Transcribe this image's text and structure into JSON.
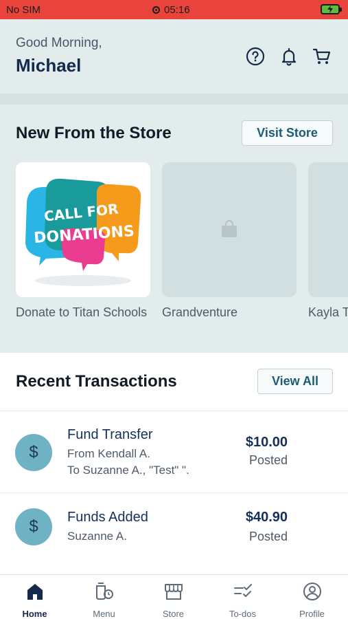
{
  "status_bar": {
    "carrier": "No SIM",
    "time": "05:16"
  },
  "header": {
    "greeting": "Good Morning,",
    "user_name": "Michael"
  },
  "store": {
    "title": "New From the Store",
    "visit_button": "Visit Store",
    "products": [
      {
        "name": "Donate to Titan Schools",
        "image_text": "CALL FOR DONATIONS"
      },
      {
        "name": "Grandventure"
      },
      {
        "name": "Kayla T"
      }
    ]
  },
  "transactions": {
    "title": "Recent Transactions",
    "view_all_button": "View All",
    "items": [
      {
        "icon": "$",
        "title": "Fund Transfer",
        "line1": "From Kendall A.",
        "line2": "To Suzanne A., \"Test\" \".",
        "amount": "$10.00",
        "status": "Posted"
      },
      {
        "icon": "$",
        "title": "Funds Added",
        "line1": "Suzanne A.",
        "amount": "$40.90",
        "status": "Posted"
      }
    ]
  },
  "tab_bar": {
    "tabs": [
      {
        "label": "Home",
        "icon": "home-icon",
        "active": true
      },
      {
        "label": "Menu",
        "icon": "menu-icon"
      },
      {
        "label": "Store",
        "icon": "store-icon"
      },
      {
        "label": "To-dos",
        "icon": "todos-icon"
      },
      {
        "label": "Profile",
        "icon": "profile-icon"
      }
    ]
  },
  "colors": {
    "status_bar": "#e8443c",
    "header_bg": "#e2eced",
    "accent": "#1d5b76",
    "transaction_icon": "#6fb2c4"
  }
}
